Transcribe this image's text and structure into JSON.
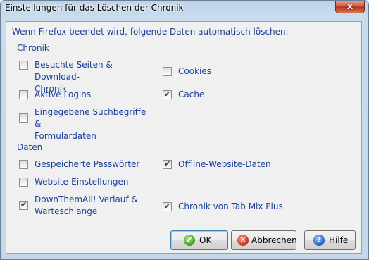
{
  "window": {
    "title": "Einstellungen für das Löschen der Chronik",
    "close_glyph": "x"
  },
  "intro": "Wenn Firefox beendet wird, folgende Daten automatisch löschen:",
  "sections": {
    "chronik": {
      "heading": "Chronik",
      "items": [
        {
          "label": "Besuchte Seiten & Download-\nChronik",
          "checked": false
        },
        {
          "label": "Cookies",
          "checked": false
        },
        {
          "label": "Aktive Logins",
          "checked": false
        },
        {
          "label": "Cache",
          "checked": true
        },
        {
          "label": "Eingegebene Suchbegriffe &\nFormulardaten",
          "checked": false
        }
      ]
    },
    "daten": {
      "heading": "Daten",
      "items": [
        {
          "label": "Gespeicherte Passwörter",
          "checked": false
        },
        {
          "label": "Offline-Website-Daten",
          "checked": true
        },
        {
          "label": "Website-Einstellungen",
          "checked": false
        },
        {
          "label": "DownThemAll! Verlauf &\nWarteschlange",
          "checked": true
        },
        {
          "label": "Chronik von Tab Mix Plus",
          "checked": true
        }
      ]
    }
  },
  "buttons": {
    "ok": {
      "label": "OK",
      "icon": "checkmark-icon"
    },
    "cancel": {
      "label": "Abbrechen",
      "icon": "cancel-icon"
    },
    "help": {
      "label": "Hilfe",
      "icon": "help-icon"
    }
  }
}
